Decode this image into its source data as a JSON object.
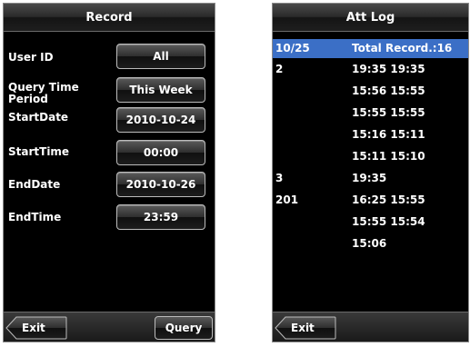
{
  "record_screen": {
    "title": "Record",
    "fields": [
      {
        "label": "User ID",
        "value": "All"
      },
      {
        "label": "Query Time Period",
        "value": "This Week"
      },
      {
        "label": "StartDate",
        "value": "2010-10-24"
      },
      {
        "label": "StartTime",
        "value": "00:00"
      },
      {
        "label": "EndDate",
        "value": "2010-10-26"
      },
      {
        "label": "EndTime",
        "value": "23:59"
      }
    ],
    "exit_label": "Exit",
    "query_label": "Query"
  },
  "att_log_screen": {
    "title": "Att Log",
    "rows": [
      {
        "id": "10/25",
        "value": "Total Record.:16",
        "selected": true
      },
      {
        "id": "2",
        "value": "19:35 19:35"
      },
      {
        "id": "",
        "value": "15:56 15:55"
      },
      {
        "id": "",
        "value": "15:55 15:55"
      },
      {
        "id": "",
        "value": "15:16 15:11"
      },
      {
        "id": "",
        "value": "15:11 15:10"
      },
      {
        "id": "3",
        "value": "19:35"
      },
      {
        "id": "201",
        "value": "16:25 15:55"
      },
      {
        "id": "",
        "value": "15:55 15:54"
      },
      {
        "id": "",
        "value": "15:06"
      }
    ],
    "exit_label": "Exit"
  },
  "colors": {
    "selected_row": "#3b6fc6",
    "screen_background": "#000000"
  }
}
